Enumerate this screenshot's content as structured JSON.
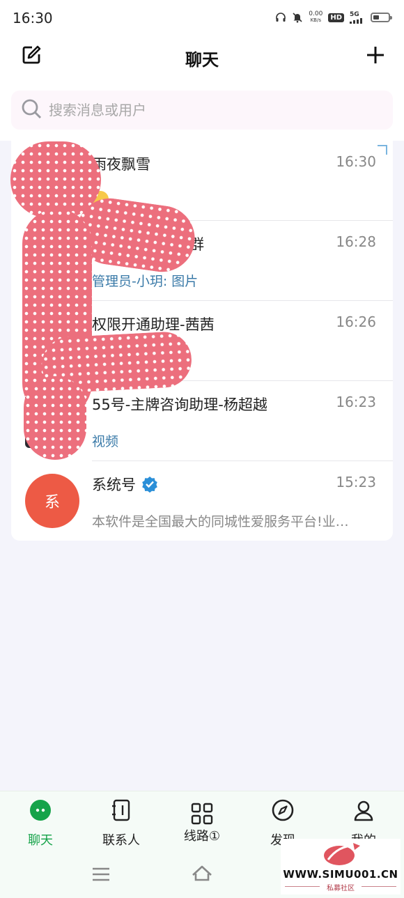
{
  "status_bar": {
    "time": "16:30",
    "network_speed_value": "0.00",
    "network_speed_unit": "KB/s",
    "hd_label": "HD",
    "signal_label": "5G"
  },
  "nav": {
    "title": "聊天"
  },
  "search": {
    "placeholder": "搜索消息或用户"
  },
  "chats": [
    {
      "name": "雨夜飘雪",
      "time": "16:30",
      "preview": ""
    },
    {
      "name": "群",
      "time": "16:28",
      "preview": "管理员-小玥: 图片"
    },
    {
      "name": "权限开通助理-茜茜",
      "time": "16:26",
      "preview": ""
    },
    {
      "name": "55号-主牌咨询助理-杨超越",
      "time": "16:23",
      "preview": "视频"
    },
    {
      "name": "系统号",
      "time": "15:23",
      "preview": "本软件是全国最大的同城性爱服务平台!业…",
      "avatar_text": "系"
    }
  ],
  "tabs": [
    {
      "label": "聊天",
      "icon": "chat-bubble-icon",
      "active": true
    },
    {
      "label": "联系人",
      "icon": "contacts-book-icon"
    },
    {
      "label": "线路①",
      "icon": "grid-icon"
    },
    {
      "label": "发现",
      "icon": "compass-icon"
    },
    {
      "label": "我的",
      "icon": "user-icon"
    }
  ],
  "watermark": {
    "site": "WWW.SIMU001.CN",
    "subtitle": "私募社区"
  },
  "colors": {
    "accent_green": "#16a34a",
    "system_avatar": "#ed5a45",
    "preview_blue": "#3a7aa8",
    "verified_blue": "#2b8fd8"
  }
}
